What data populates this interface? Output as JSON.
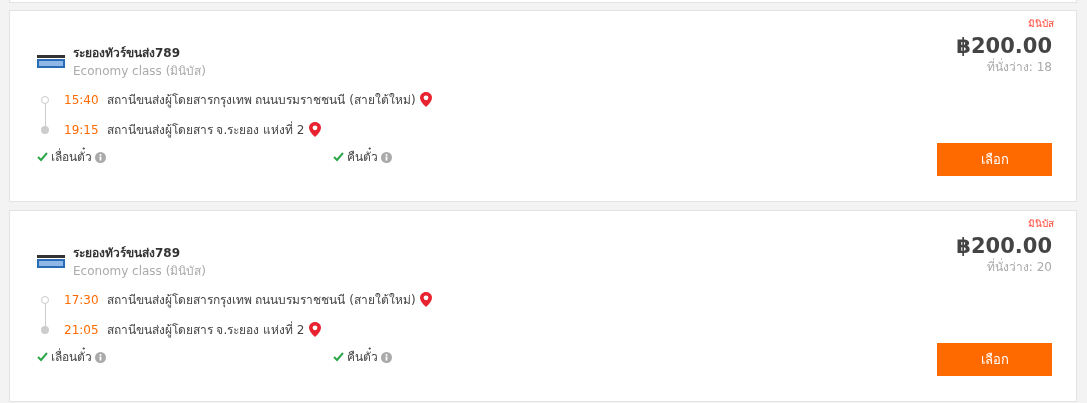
{
  "trips": [
    {
      "tag": "มินิบัส",
      "operator": "ระยองทัวร์ขนส่ง789",
      "class": "Economy class (มินิบัส)",
      "price": "฿200.00",
      "seats": "ที่นั่งว่าง: 18",
      "stops": [
        {
          "time": "15:40",
          "station": "สถานีขนส่งผู้โดยสารกรุงเทพ ถนนบรมราชชนนี (สายใต้ใหม่)"
        },
        {
          "time": "19:15",
          "station": "สถานีขนส่งผู้โดยสาร จ.ระยอง แห่งที่ 2"
        }
      ],
      "policies": [
        {
          "label": "เลื่อนตั๋ว",
          "checked": true
        },
        {
          "label": "คืนตั๋ว",
          "checked": true
        }
      ],
      "button": "เลือก"
    },
    {
      "tag": "มินิบัส",
      "operator": "ระยองทัวร์ขนส่ง789",
      "class": "Economy class (มินิบัส)",
      "price": "฿200.00",
      "seats": "ที่นั่งว่าง: 20",
      "stops": [
        {
          "time": "17:30",
          "station": "สถานีขนส่งผู้โดยสารกรุงเทพ ถนนบรมราชชนนี (สายใต้ใหม่)"
        },
        {
          "time": "21:05",
          "station": "สถานีขนส่งผู้โดยสาร จ.ระยอง แห่งที่ 2"
        }
      ],
      "policies": [
        {
          "label": "เลื่อนตั๋ว",
          "checked": true
        },
        {
          "label": "คืนตั๋ว",
          "checked": true
        }
      ],
      "button": "เลือก"
    }
  ]
}
